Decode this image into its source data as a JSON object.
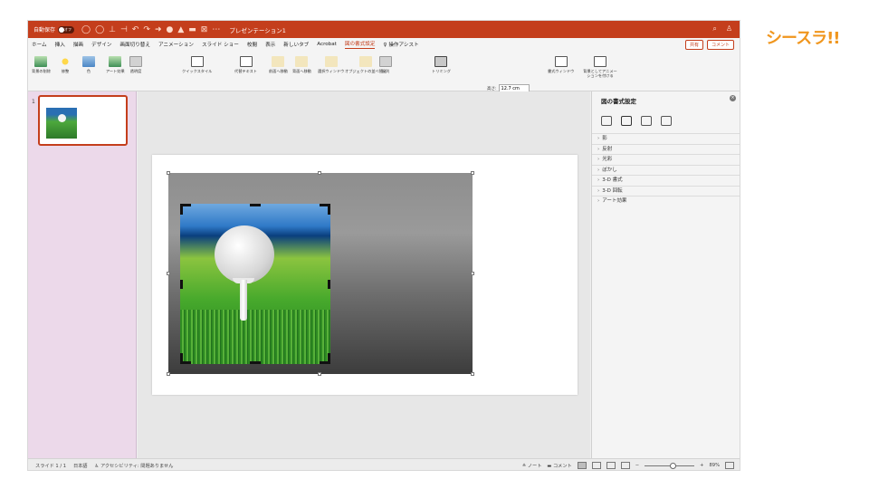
{
  "brand": "シースラ!!",
  "titlebar": {
    "autosave_label": "自動保存",
    "autosave_state": "オフ",
    "document_title": "プレゼンテーション1"
  },
  "tabs": [
    {
      "label": "ホーム"
    },
    {
      "label": "挿入"
    },
    {
      "label": "描画"
    },
    {
      "label": "デザイン"
    },
    {
      "label": "画面切り替え"
    },
    {
      "label": "アニメーション"
    },
    {
      "label": "スライド ショー"
    },
    {
      "label": "校閲"
    },
    {
      "label": "表示"
    },
    {
      "label": "新しいタブ"
    },
    {
      "label": "Acrobat"
    },
    {
      "label": "図の書式設定",
      "active": true
    },
    {
      "label": "操作アシスト"
    }
  ],
  "tab_actions": {
    "share": "共有",
    "comment": "コメント"
  },
  "ribbon": {
    "remove_bg": "背景の削除",
    "corrections": "修整",
    "color": "色",
    "artistic": "アート効果",
    "transparency": "透明度",
    "quick_styles": "クイックスタイル",
    "alt_text": "代替テキスト",
    "bring_forward": "前面へ移動",
    "send_backward": "背面へ移動",
    "selection_pane": "選択ウィンドウ",
    "reorder": "オブジェクトの並べ替え",
    "align": "配列",
    "crop": "トリミング",
    "height_label": "高さ:",
    "height_value": "12.7 cm",
    "width_label": "幅:",
    "width_value": "11.95 cm",
    "format_pane": "書式ウィンドウ",
    "save_bg": "背景としてアニメーションを付ける"
  },
  "thumbnails": {
    "slide_number": "1"
  },
  "format_pane": {
    "title": "図の書式設定",
    "items": [
      "影",
      "反射",
      "光彩",
      "ぼかし",
      "3-D 書式",
      "3-D 回転",
      "アート効果"
    ]
  },
  "status": {
    "slide": "スライド 1 / 1",
    "language": "日本語",
    "accessibility": "アクセシビリティ: 問題ありません",
    "notes": "ノート",
    "comments": "コメント",
    "zoom": "89%"
  }
}
